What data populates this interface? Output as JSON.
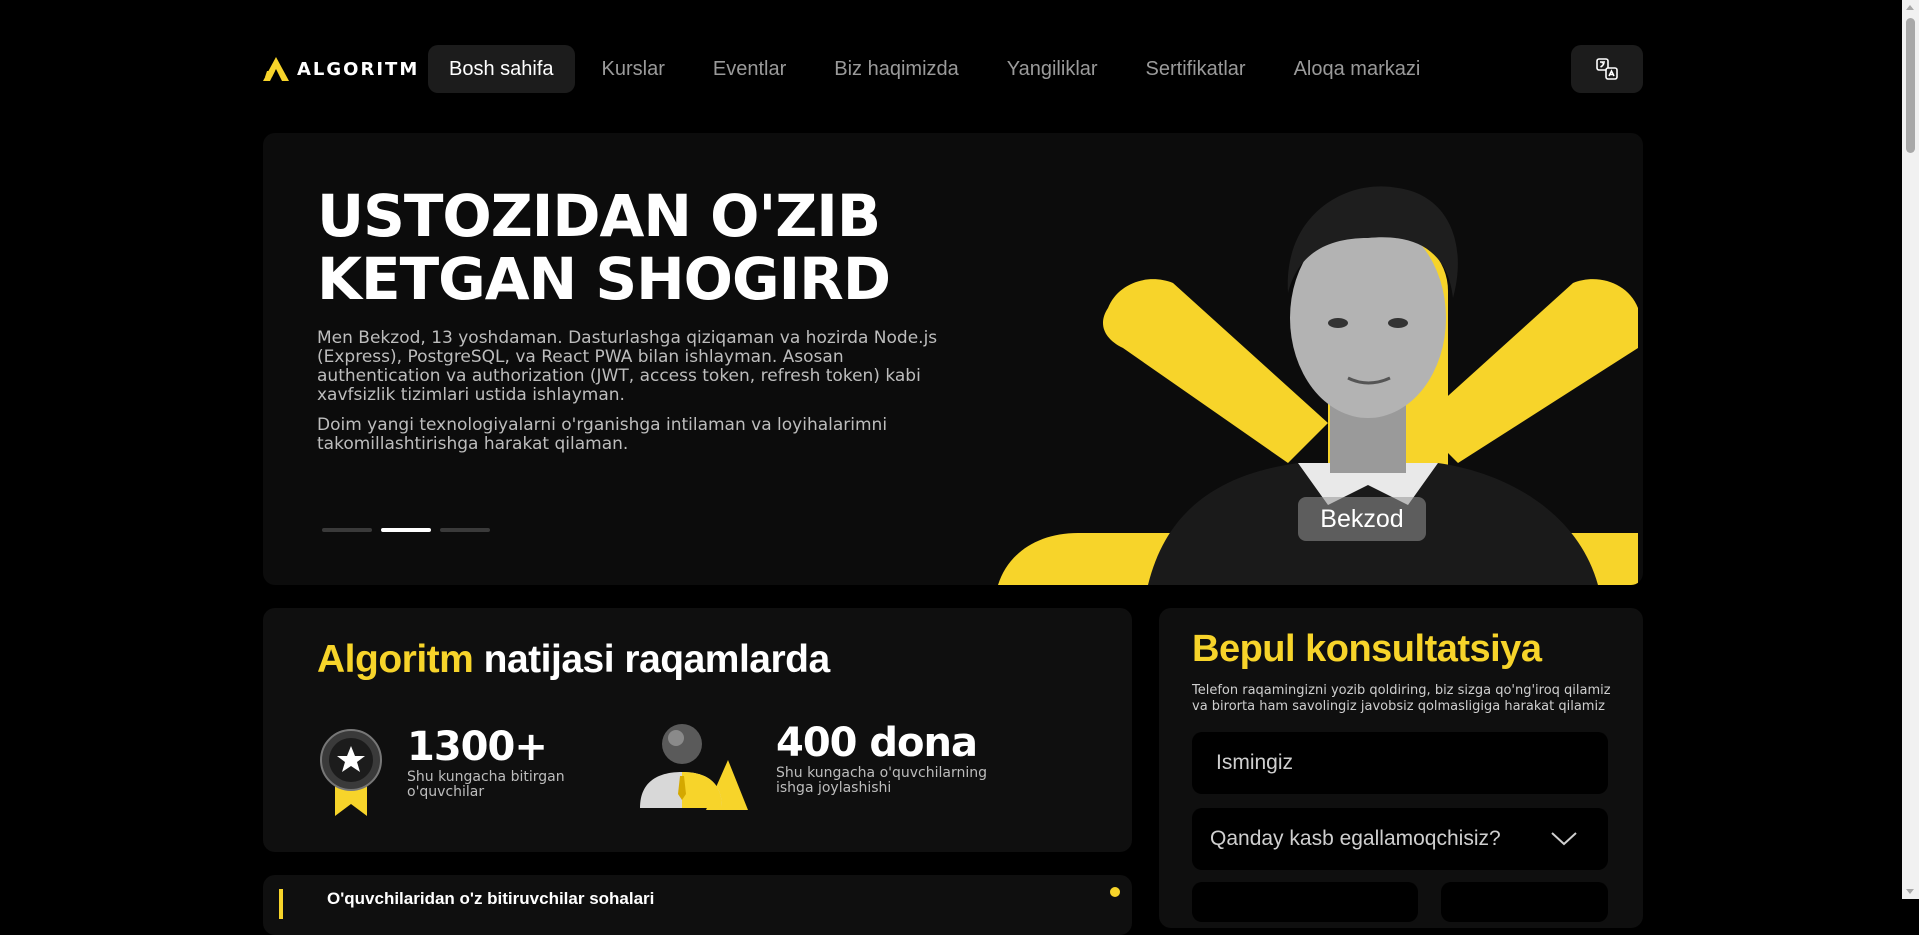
{
  "brand": {
    "name": "ALGORITM",
    "accent": "#f7d42a"
  },
  "nav": {
    "items": [
      {
        "label": "Bosh sahifa",
        "active": true
      },
      {
        "label": "Kurslar",
        "active": false
      },
      {
        "label": "Eventlar",
        "active": false
      },
      {
        "label": "Biz haqimizda",
        "active": false
      },
      {
        "label": "Yangiliklar",
        "active": false
      },
      {
        "label": "Sertifikatlar",
        "active": false
      },
      {
        "label": "Aloqa markazi",
        "active": false
      }
    ],
    "lang_icon": "translate-icon"
  },
  "hero": {
    "title_line1": "USTOZIDAN O'ZIB",
    "title_line2": "KETGAN SHOGIRD",
    "paragraph1": "Men Bekzod, 13 yoshdaman. Dasturlashga qiziqaman va hozirda Node.js (Express), PostgreSQL, va React PWA bilan ishlayman. Asosan authentication va authorization (JWT, access token, refresh token) kabi xavfsizlik tizimlari ustida ishlayman.",
    "paragraph2": "Doim yangi texnologiyalarni o'rganishga intilaman va loyihalarimni takomillashtirishga harakat qilaman.",
    "name_tag": "Bekzod",
    "slides": 3,
    "active_slide": 2
  },
  "stats": {
    "title_accent": "Algoritm",
    "title_rest": " natijasi raqamlarda",
    "items": [
      {
        "value": "1300+",
        "description": "Shu kungacha bitirgan o'quvchilar",
        "icon": "medal-icon"
      },
      {
        "value": "400 dona",
        "description": "Shu kungacha o'quvchilarning ishga joylashishi",
        "icon": "employee-icon"
      }
    ]
  },
  "consult": {
    "title": "Bepul konsultatsiya",
    "description": "Telefon raqamingizni yozib qoldiring, biz sizga qo'ng'iroq qilamiz va birorta ham savolingiz javobsiz qolmasligiga harakat qilamiz",
    "name_placeholder": "Ismingiz",
    "select_value": "Qanday kasb egallamoqchisiz?"
  },
  "bottom": {
    "text": "O'quvchilaridan o'z bitiruvchilar sohalari"
  }
}
